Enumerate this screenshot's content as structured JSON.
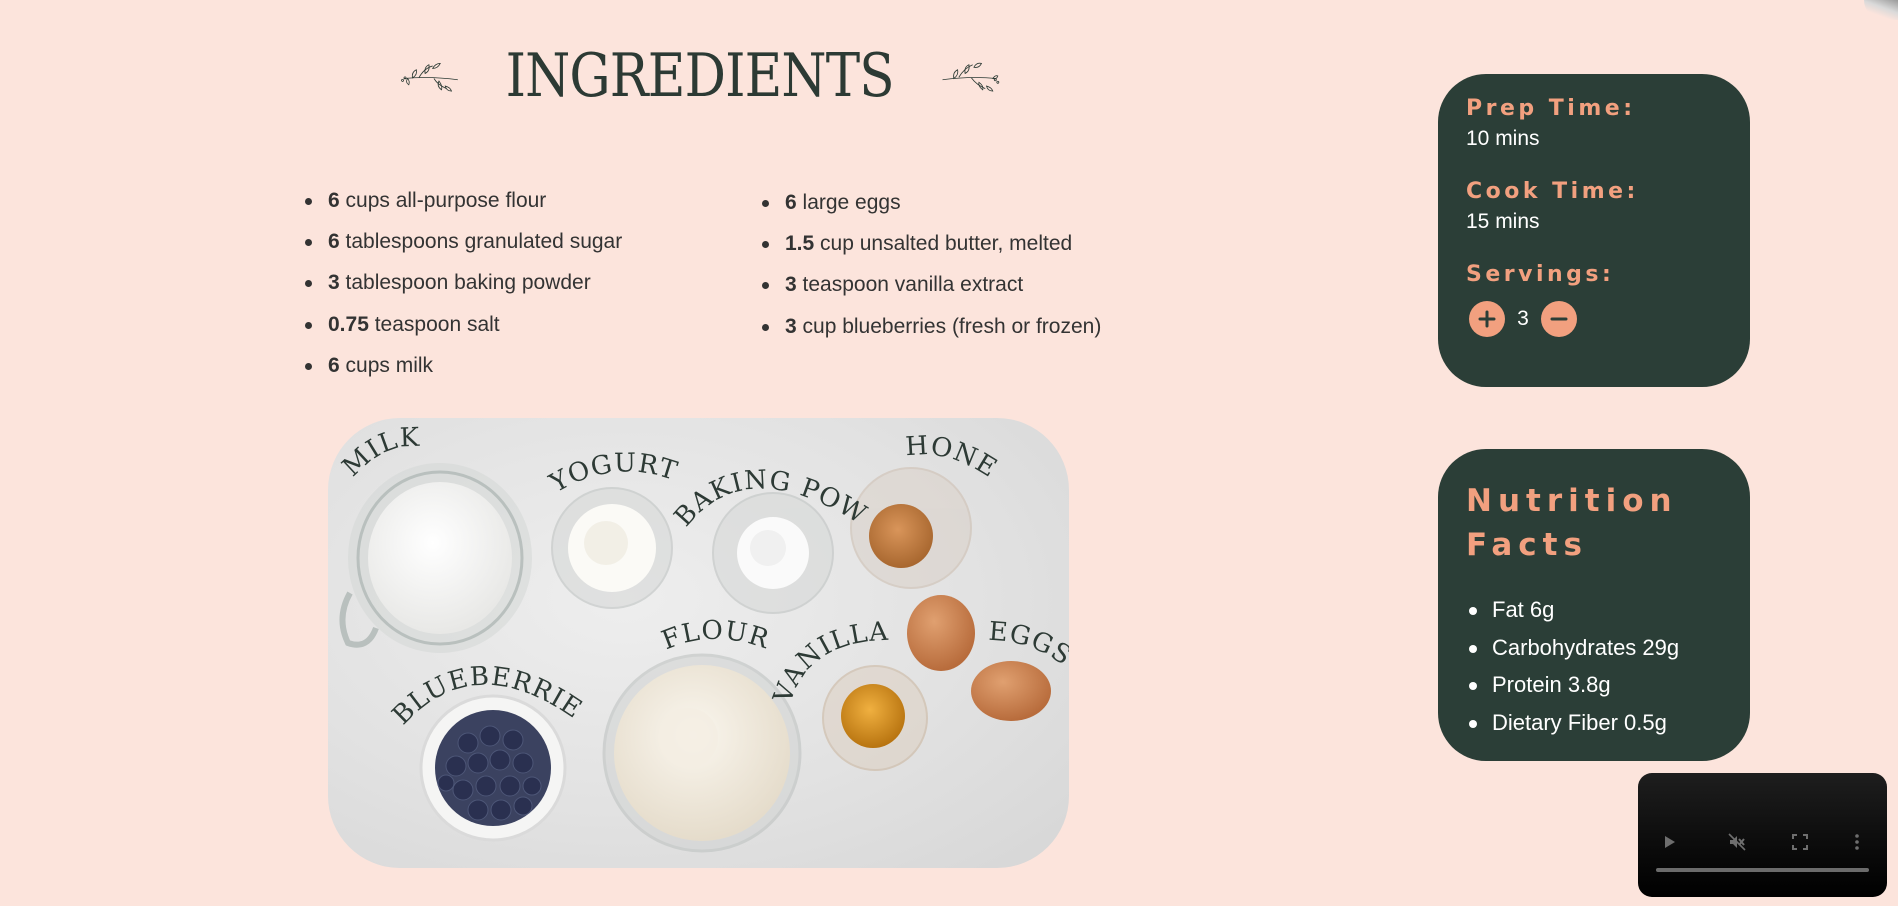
{
  "title": "INGREDIENTS",
  "ingredients_left": [
    {
      "qty": "6",
      "text": " cups all-purpose flour"
    },
    {
      "qty": "6",
      "text": " tablespoons granulated sugar"
    },
    {
      "qty": "3",
      "text": " tablespoon baking powder"
    },
    {
      "qty": "0.75",
      "text": " teaspoon salt"
    },
    {
      "qty": "6",
      "text": " cups milk"
    }
  ],
  "ingredients_right": [
    {
      "qty": "6",
      "text": " large eggs"
    },
    {
      "qty": "1.5",
      "text": " cup unsalted butter, melted"
    },
    {
      "qty": "3",
      "text": " teaspoon vanilla extract"
    },
    {
      "qty": "3",
      "text": " cup blueberries (fresh or frozen)"
    }
  ],
  "photo_labels": {
    "milk": "MILK",
    "yogurt": "YOGURT",
    "baking_powder": "BAKING POWDER",
    "honey": "HONEY",
    "flour": "FLOUR",
    "vanilla": "VANILLA",
    "eggs": "EGGS",
    "blueberries": "BLUEBERRIES"
  },
  "recipe_info": {
    "prep_label": "Prep Time:",
    "prep_value": "10 mins",
    "cook_label": "Cook Time:",
    "cook_value": "15 mins",
    "servings_label": "Servings:",
    "servings_value": "3"
  },
  "nutrition": {
    "title": "Nutrition Facts",
    "items": [
      "Fat 6g",
      "Carbohydrates 29g",
      "Protein 3.8g",
      "Dietary Fiber 0.5g"
    ]
  },
  "colors": {
    "background": "#fce4dc",
    "card": "#2b3e37",
    "accent": "#f2a07f",
    "title": "#2c3a34"
  },
  "icons": {
    "increment": "plus-icon",
    "decrement": "minus-icon",
    "play": "play-icon",
    "mute": "volume-muted-icon",
    "fullscreen": "fullscreen-icon",
    "more": "more-vertical-icon"
  }
}
